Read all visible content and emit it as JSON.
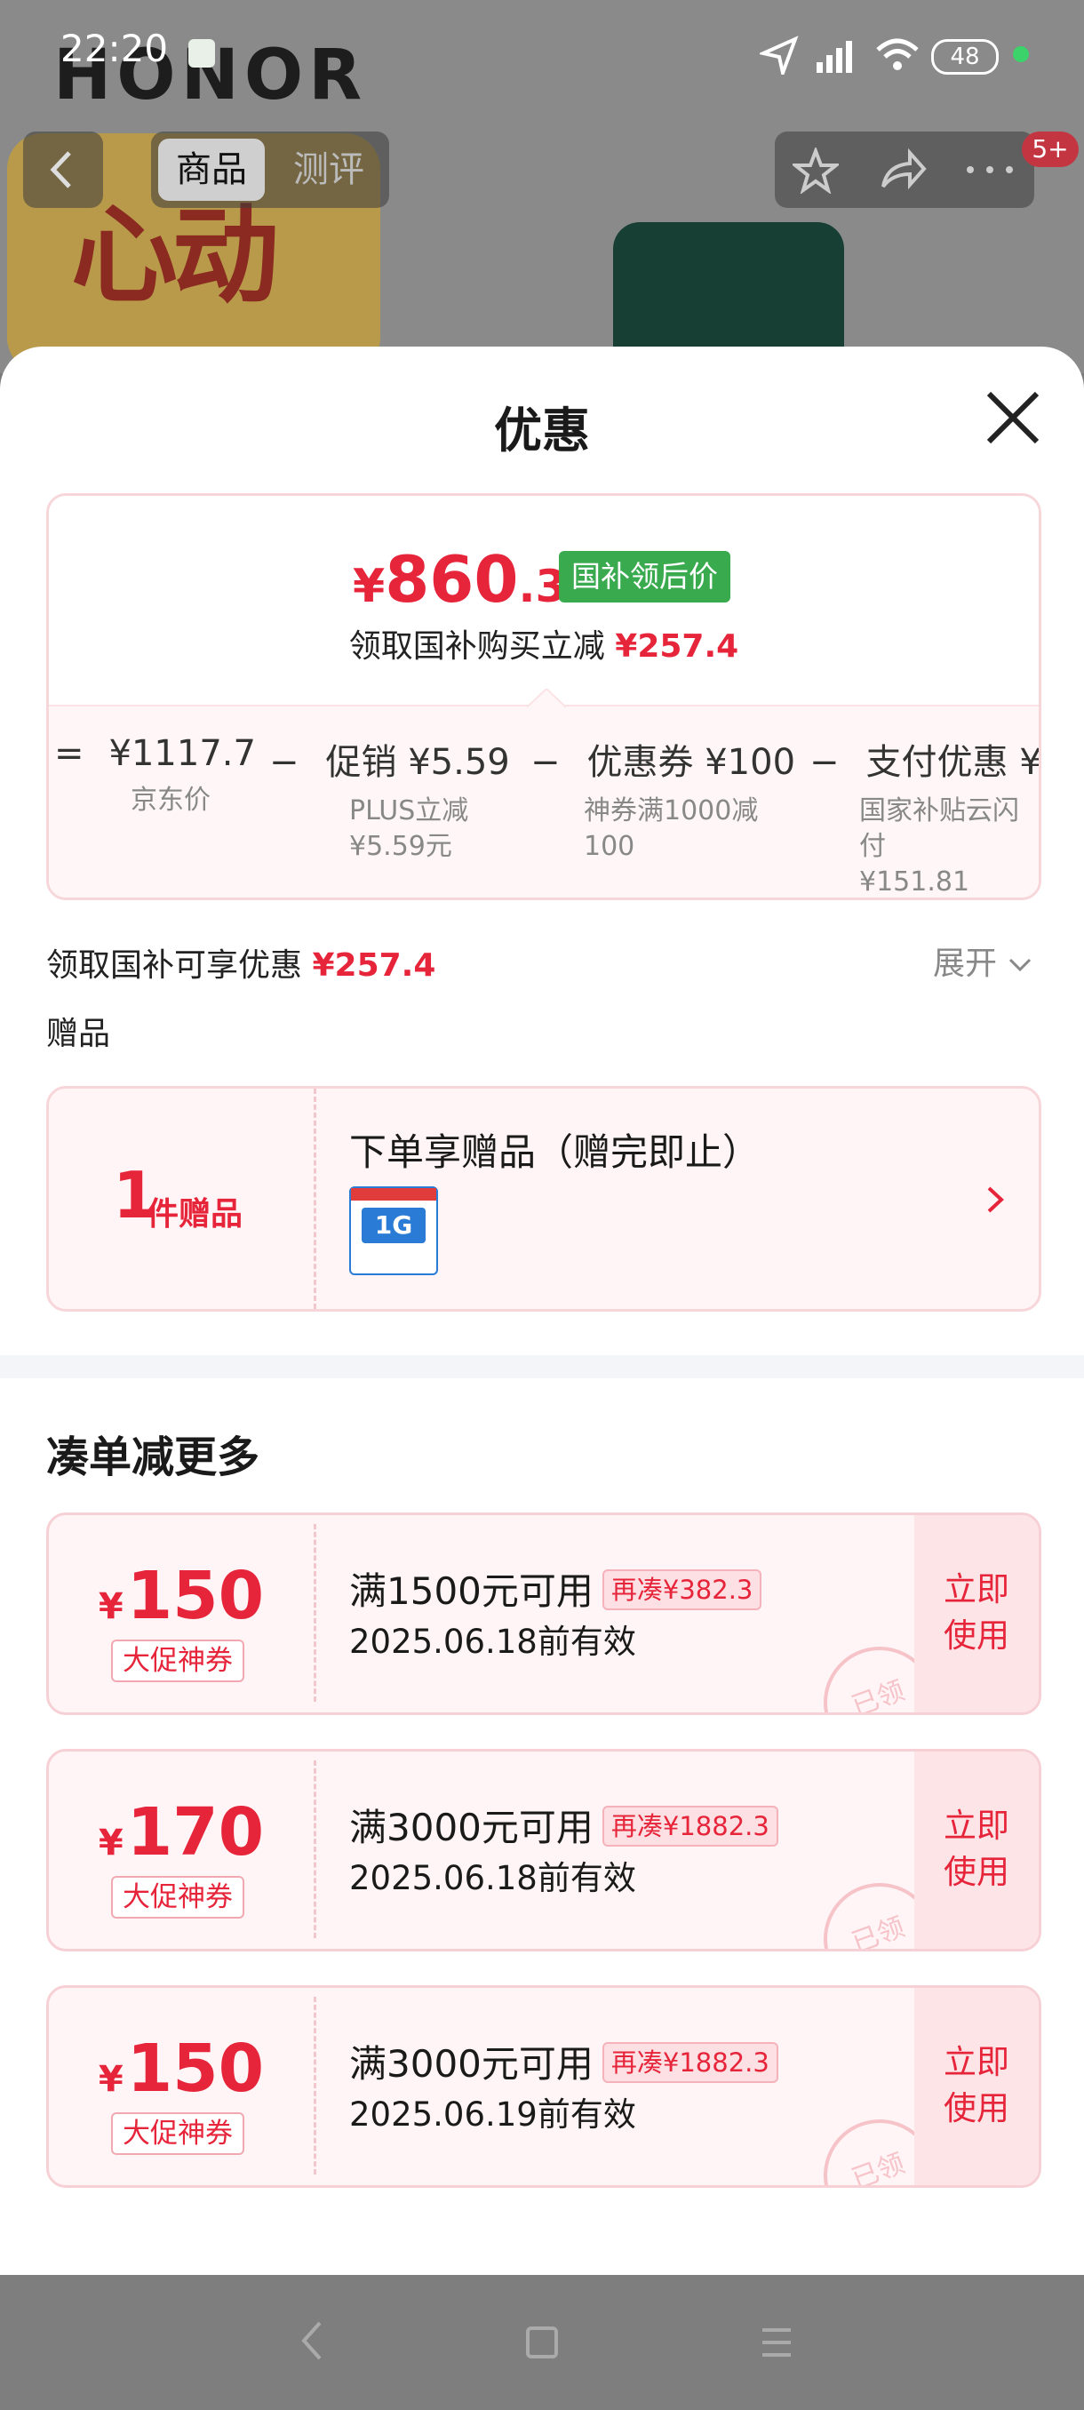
{
  "status_bar": {
    "time": "22:20",
    "battery": "48"
  },
  "background": {
    "brand": "HONOR",
    "promo_text": "心动",
    "tabs": [
      "商品",
      "测评"
    ],
    "badge": "5+"
  },
  "sheet": {
    "title": "优惠",
    "price": {
      "currency": "¥",
      "value": "860",
      "decimal": ".3",
      "badge": "国补领后价",
      "subtitle_prefix": "领取国补购买立减",
      "subtitle_amount": "¥257.4"
    },
    "calc": [
      {
        "op": "=",
        "main": "¥1117.7",
        "sub": "京东价"
      },
      {
        "op": "−",
        "main": "促销 ¥5.59",
        "sub": "PLUS立减\n¥5.59元"
      },
      {
        "op": "−",
        "main": "优惠券 ¥100",
        "sub": "神券满1000减\n100"
      },
      {
        "op": "−",
        "main": "支付优惠 ¥",
        "sub": "国家补贴云闪付\n¥151.81"
      }
    ],
    "subsidy": {
      "label": "领取国补可享优惠",
      "amount": "¥257.4",
      "expand": "展开"
    },
    "gift_section_title": "赠品",
    "gift": {
      "count": "1",
      "count_unit": "件赠品",
      "title": "下单享赠品（赠完即止）",
      "thumb_text": "1G"
    },
    "more_section_title": "凑单减更多",
    "coupons": [
      {
        "currency": "¥",
        "amount": "150",
        "tag": "大促神券",
        "condition": "满1500元可用",
        "more": "再凑¥382.3",
        "valid": "2025.06.18前有效",
        "action": "立即使用",
        "stamp": "已领"
      },
      {
        "currency": "¥",
        "amount": "170",
        "tag": "大促神券",
        "condition": "满3000元可用",
        "more": "再凑¥1882.3",
        "valid": "2025.06.18前有效",
        "action": "立即使用",
        "stamp": "已领"
      },
      {
        "currency": "¥",
        "amount": "150",
        "tag": "大促神券",
        "condition": "满3000元可用",
        "more": "再凑¥1882.3",
        "valid": "2025.06.19前有效",
        "action": "立即使用",
        "stamp": "已领"
      }
    ]
  },
  "colors": {
    "accent": "#e6243a",
    "badge_green": "#3aaa4f"
  }
}
